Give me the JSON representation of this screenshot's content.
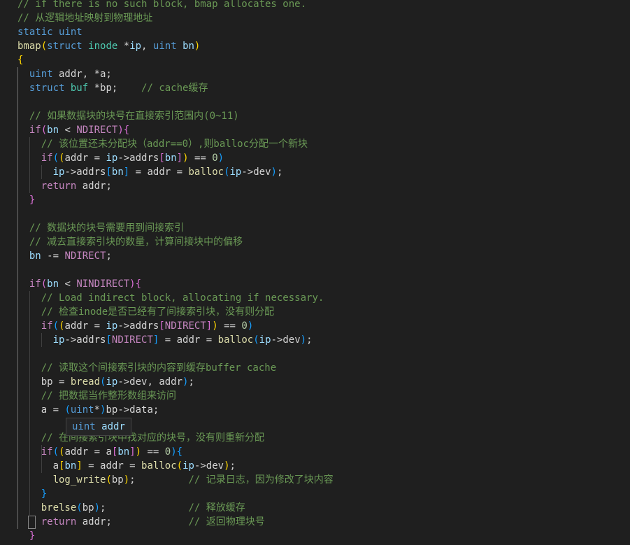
{
  "colors": {
    "background": "#1f1f1f",
    "default": "#d4d4d4",
    "keyword": "#569cd6",
    "type": "#4ec9b0",
    "control": "#c586c0",
    "function": "#dcdcaa",
    "variable": "#9cdcfe",
    "comment": "#6a9955",
    "number": "#b5cea8",
    "macro": "#c586c0",
    "bracket1": "#ffd700",
    "bracket2": "#da70d6",
    "bracket3": "#179fff"
  },
  "editor": {
    "lines": [
      [
        {
          "t": "// if there is no such block, bmap allocates one.",
          "c": "comment"
        }
      ],
      [
        {
          "t": "// 从逻辑地址映射到物理地址",
          "c": "comment"
        }
      ],
      [
        {
          "t": "static",
          "c": "keyword"
        },
        {
          "t": " ",
          "c": "default"
        },
        {
          "t": "uint",
          "c": "keyword"
        }
      ],
      [
        {
          "t": "bmap",
          "c": "function"
        },
        {
          "t": "(",
          "c": "bracket1"
        },
        {
          "t": "struct",
          "c": "keyword"
        },
        {
          "t": " ",
          "c": "default"
        },
        {
          "t": "inode",
          "c": "type"
        },
        {
          "t": " *",
          "c": "default"
        },
        {
          "t": "ip",
          "c": "variable"
        },
        {
          "t": ", ",
          "c": "default"
        },
        {
          "t": "uint",
          "c": "keyword"
        },
        {
          "t": " ",
          "c": "default"
        },
        {
          "t": "bn",
          "c": "variable"
        },
        {
          "t": ")",
          "c": "bracket1"
        }
      ],
      [
        {
          "t": "{",
          "c": "bracket1"
        }
      ],
      [
        {
          "t": "  ",
          "c": "default"
        },
        {
          "t": "uint",
          "c": "keyword"
        },
        {
          "t": " addr, *a;",
          "c": "default"
        }
      ],
      [
        {
          "t": "  ",
          "c": "default"
        },
        {
          "t": "struct",
          "c": "keyword"
        },
        {
          "t": " ",
          "c": "default"
        },
        {
          "t": "buf",
          "c": "type"
        },
        {
          "t": " *bp;    ",
          "c": "default"
        },
        {
          "t": "// cache缓存",
          "c": "comment"
        }
      ],
      [],
      [
        {
          "t": "  ",
          "c": "default"
        },
        {
          "t": "// 如果数据块的块号在直接索引范围内(0~11)",
          "c": "comment"
        }
      ],
      [
        {
          "t": "  ",
          "c": "default"
        },
        {
          "t": "if",
          "c": "control"
        },
        {
          "t": "(",
          "c": "bracket2"
        },
        {
          "t": "bn",
          "c": "variable"
        },
        {
          "t": " < ",
          "c": "default"
        },
        {
          "t": "NDIRECT",
          "c": "macro"
        },
        {
          "t": ")",
          "c": "bracket2"
        },
        {
          "t": "{",
          "c": "bracket2"
        }
      ],
      [
        {
          "t": "    ",
          "c": "default"
        },
        {
          "t": "// 该位置还未分配块（addr==0）,则balloc分配一个新块",
          "c": "comment"
        }
      ],
      [
        {
          "t": "    ",
          "c": "default"
        },
        {
          "t": "if",
          "c": "control"
        },
        {
          "t": "(",
          "c": "bracket3"
        },
        {
          "t": "(",
          "c": "bracket1"
        },
        {
          "t": "addr = ",
          "c": "default"
        },
        {
          "t": "ip",
          "c": "variable"
        },
        {
          "t": "->addrs",
          "c": "default"
        },
        {
          "t": "[",
          "c": "bracket2"
        },
        {
          "t": "bn",
          "c": "variable"
        },
        {
          "t": "]",
          "c": "bracket2"
        },
        {
          "t": ")",
          "c": "bracket1"
        },
        {
          "t": " == ",
          "c": "default"
        },
        {
          "t": "0",
          "c": "number"
        },
        {
          "t": ")",
          "c": "bracket3"
        }
      ],
      [
        {
          "t": "      ",
          "c": "default"
        },
        {
          "t": "ip",
          "c": "variable"
        },
        {
          "t": "->addrs",
          "c": "default"
        },
        {
          "t": "[",
          "c": "bracket3"
        },
        {
          "t": "bn",
          "c": "variable"
        },
        {
          "t": "]",
          "c": "bracket3"
        },
        {
          "t": " = addr = ",
          "c": "default"
        },
        {
          "t": "balloc",
          "c": "function"
        },
        {
          "t": "(",
          "c": "bracket3"
        },
        {
          "t": "ip",
          "c": "variable"
        },
        {
          "t": "->dev",
          "c": "default"
        },
        {
          "t": ")",
          "c": "bracket3"
        },
        {
          "t": ";",
          "c": "default"
        }
      ],
      [
        {
          "t": "    ",
          "c": "default"
        },
        {
          "t": "return",
          "c": "control"
        },
        {
          "t": " addr;",
          "c": "default"
        }
      ],
      [
        {
          "t": "  ",
          "c": "default"
        },
        {
          "t": "}",
          "c": "bracket2"
        }
      ],
      [],
      [
        {
          "t": "  ",
          "c": "default"
        },
        {
          "t": "// 数据块的块号需要用到间接索引",
          "c": "comment"
        }
      ],
      [
        {
          "t": "  ",
          "c": "default"
        },
        {
          "t": "// 减去直接索引块的数量，计算间接块中的偏移",
          "c": "comment"
        }
      ],
      [
        {
          "t": "  ",
          "c": "default"
        },
        {
          "t": "bn",
          "c": "variable"
        },
        {
          "t": " -= ",
          "c": "default"
        },
        {
          "t": "NDIRECT",
          "c": "macro"
        },
        {
          "t": ";",
          "c": "default"
        }
      ],
      [],
      [
        {
          "t": "  ",
          "c": "default"
        },
        {
          "t": "if",
          "c": "control"
        },
        {
          "t": "(",
          "c": "bracket2"
        },
        {
          "t": "bn",
          "c": "variable"
        },
        {
          "t": " < ",
          "c": "default"
        },
        {
          "t": "NINDIRECT",
          "c": "macro"
        },
        {
          "t": ")",
          "c": "bracket2"
        },
        {
          "t": "{",
          "c": "bracket2"
        }
      ],
      [
        {
          "t": "    ",
          "c": "default"
        },
        {
          "t": "// Load indirect block, allocating if necessary.",
          "c": "comment"
        }
      ],
      [
        {
          "t": "    ",
          "c": "default"
        },
        {
          "t": "// 检查inode是否已经有了间接索引块，没有则分配",
          "c": "comment"
        }
      ],
      [
        {
          "t": "    ",
          "c": "default"
        },
        {
          "t": "if",
          "c": "control"
        },
        {
          "t": "(",
          "c": "bracket3"
        },
        {
          "t": "(",
          "c": "bracket1"
        },
        {
          "t": "addr = ",
          "c": "default"
        },
        {
          "t": "ip",
          "c": "variable"
        },
        {
          "t": "->addrs",
          "c": "default"
        },
        {
          "t": "[",
          "c": "bracket2"
        },
        {
          "t": "NDIRECT",
          "c": "macro"
        },
        {
          "t": "]",
          "c": "bracket2"
        },
        {
          "t": ")",
          "c": "bracket1"
        },
        {
          "t": " == ",
          "c": "default"
        },
        {
          "t": "0",
          "c": "number"
        },
        {
          "t": ")",
          "c": "bracket3"
        }
      ],
      [
        {
          "t": "      ",
          "c": "default"
        },
        {
          "t": "ip",
          "c": "variable"
        },
        {
          "t": "->addrs",
          "c": "default"
        },
        {
          "t": "[",
          "c": "bracket3"
        },
        {
          "t": "NDIRECT",
          "c": "macro"
        },
        {
          "t": "]",
          "c": "bracket3"
        },
        {
          "t": " = addr = ",
          "c": "default"
        },
        {
          "t": "balloc",
          "c": "function"
        },
        {
          "t": "(",
          "c": "bracket3"
        },
        {
          "t": "ip",
          "c": "variable"
        },
        {
          "t": "->dev",
          "c": "default"
        },
        {
          "t": ")",
          "c": "bracket3"
        },
        {
          "t": ";",
          "c": "default"
        }
      ],
      [],
      [
        {
          "t": "    ",
          "c": "default"
        },
        {
          "t": "// 读取这个间接索引块的内容到缓存buffer cache",
          "c": "comment"
        }
      ],
      [
        {
          "t": "    bp = ",
          "c": "default"
        },
        {
          "t": "bread",
          "c": "function"
        },
        {
          "t": "(",
          "c": "bracket3"
        },
        {
          "t": "ip",
          "c": "variable"
        },
        {
          "t": "->dev, addr",
          "c": "default"
        },
        {
          "t": ")",
          "c": "bracket3"
        },
        {
          "t": ";",
          "c": "default"
        }
      ],
      [
        {
          "t": "    ",
          "c": "default"
        },
        {
          "t": "// 把数据当作整形数组来访问",
          "c": "comment"
        }
      ],
      [
        {
          "t": "    a = ",
          "c": "default"
        },
        {
          "t": "(",
          "c": "bracket3"
        },
        {
          "t": "uint",
          "c": "keyword"
        },
        {
          "t": "*",
          "c": "default"
        },
        {
          "t": ")",
          "c": "bracket3"
        },
        {
          "t": "bp->data;",
          "c": "default"
        }
      ],
      [],
      [
        {
          "t": "    ",
          "c": "default"
        },
        {
          "t": "// 在间接索引块中找对应的块号，没有则重新分配",
          "c": "comment"
        }
      ],
      [
        {
          "t": "    ",
          "c": "default"
        },
        {
          "t": "if",
          "c": "control"
        },
        {
          "t": "(",
          "c": "bracket3"
        },
        {
          "t": "(",
          "c": "bracket1"
        },
        {
          "t": "addr = a",
          "c": "default"
        },
        {
          "t": "[",
          "c": "bracket2"
        },
        {
          "t": "bn",
          "c": "variable"
        },
        {
          "t": "]",
          "c": "bracket2"
        },
        {
          "t": ")",
          "c": "bracket1"
        },
        {
          "t": " == ",
          "c": "default"
        },
        {
          "t": "0",
          "c": "number"
        },
        {
          "t": ")",
          "c": "bracket3"
        },
        {
          "t": "{",
          "c": "bracket3"
        }
      ],
      [
        {
          "t": "      a",
          "c": "default"
        },
        {
          "t": "[",
          "c": "bracket1"
        },
        {
          "t": "bn",
          "c": "variable"
        },
        {
          "t": "]",
          "c": "bracket1"
        },
        {
          "t": " = addr = ",
          "c": "default"
        },
        {
          "t": "balloc",
          "c": "function"
        },
        {
          "t": "(",
          "c": "bracket1"
        },
        {
          "t": "ip",
          "c": "variable"
        },
        {
          "t": "->dev",
          "c": "default"
        },
        {
          "t": ")",
          "c": "bracket1"
        },
        {
          "t": ";",
          "c": "default"
        }
      ],
      [
        {
          "t": "      ",
          "c": "default"
        },
        {
          "t": "log_write",
          "c": "function"
        },
        {
          "t": "(",
          "c": "bracket1"
        },
        {
          "t": "bp",
          "c": "default"
        },
        {
          "t": ")",
          "c": "bracket1"
        },
        {
          "t": ";         ",
          "c": "default"
        },
        {
          "t": "// 记录日志，因为修改了块内容",
          "c": "comment"
        }
      ],
      [
        {
          "t": "    ",
          "c": "default"
        },
        {
          "t": "}",
          "c": "bracket3"
        }
      ],
      [
        {
          "t": "    ",
          "c": "default"
        },
        {
          "t": "brelse",
          "c": "function"
        },
        {
          "t": "(",
          "c": "bracket3"
        },
        {
          "t": "bp",
          "c": "default"
        },
        {
          "t": ")",
          "c": "bracket3"
        },
        {
          "t": ";              ",
          "c": "default"
        },
        {
          "t": "// 释放缓存",
          "c": "comment"
        }
      ],
      [
        {
          "t": "    ",
          "c": "default"
        },
        {
          "t": "return",
          "c": "control"
        },
        {
          "t": " addr;             ",
          "c": "default"
        },
        {
          "t": "// 返回物理块号",
          "c": "comment"
        }
      ],
      [
        {
          "t": "  ",
          "c": "default"
        },
        {
          "t": "}",
          "c": "bracket2"
        }
      ]
    ]
  },
  "hover_tooltip": {
    "type": "uint",
    "name": "addr"
  }
}
